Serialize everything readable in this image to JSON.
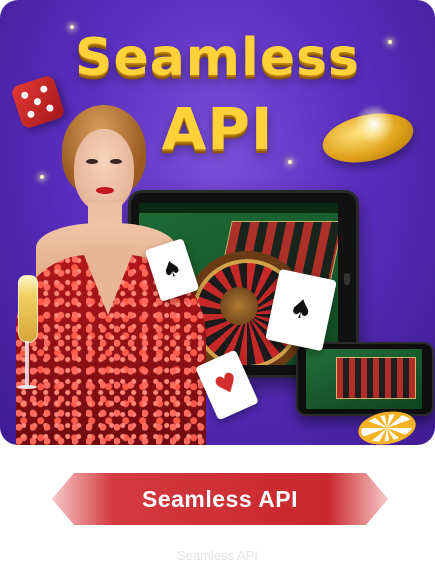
{
  "banner": {
    "headline_line1": "Seamless",
    "headline_line2": "API",
    "accent_gold": "#ffd23a",
    "background_purple": "#5a2fbf",
    "illustration": {
      "playing_card_icons": [
        "spade-icon",
        "heart-icon",
        "face-card-icon"
      ],
      "dice_icon": "dice-icon",
      "coin_icon": "gold-coin-icon",
      "chip_icon": "casino-chip-icon"
    }
  },
  "cta": {
    "label": "Seamless API",
    "gradient_start": "#c8272d",
    "gradient_end": "#f7c8c8"
  },
  "caption": {
    "text": "Seamless API"
  }
}
